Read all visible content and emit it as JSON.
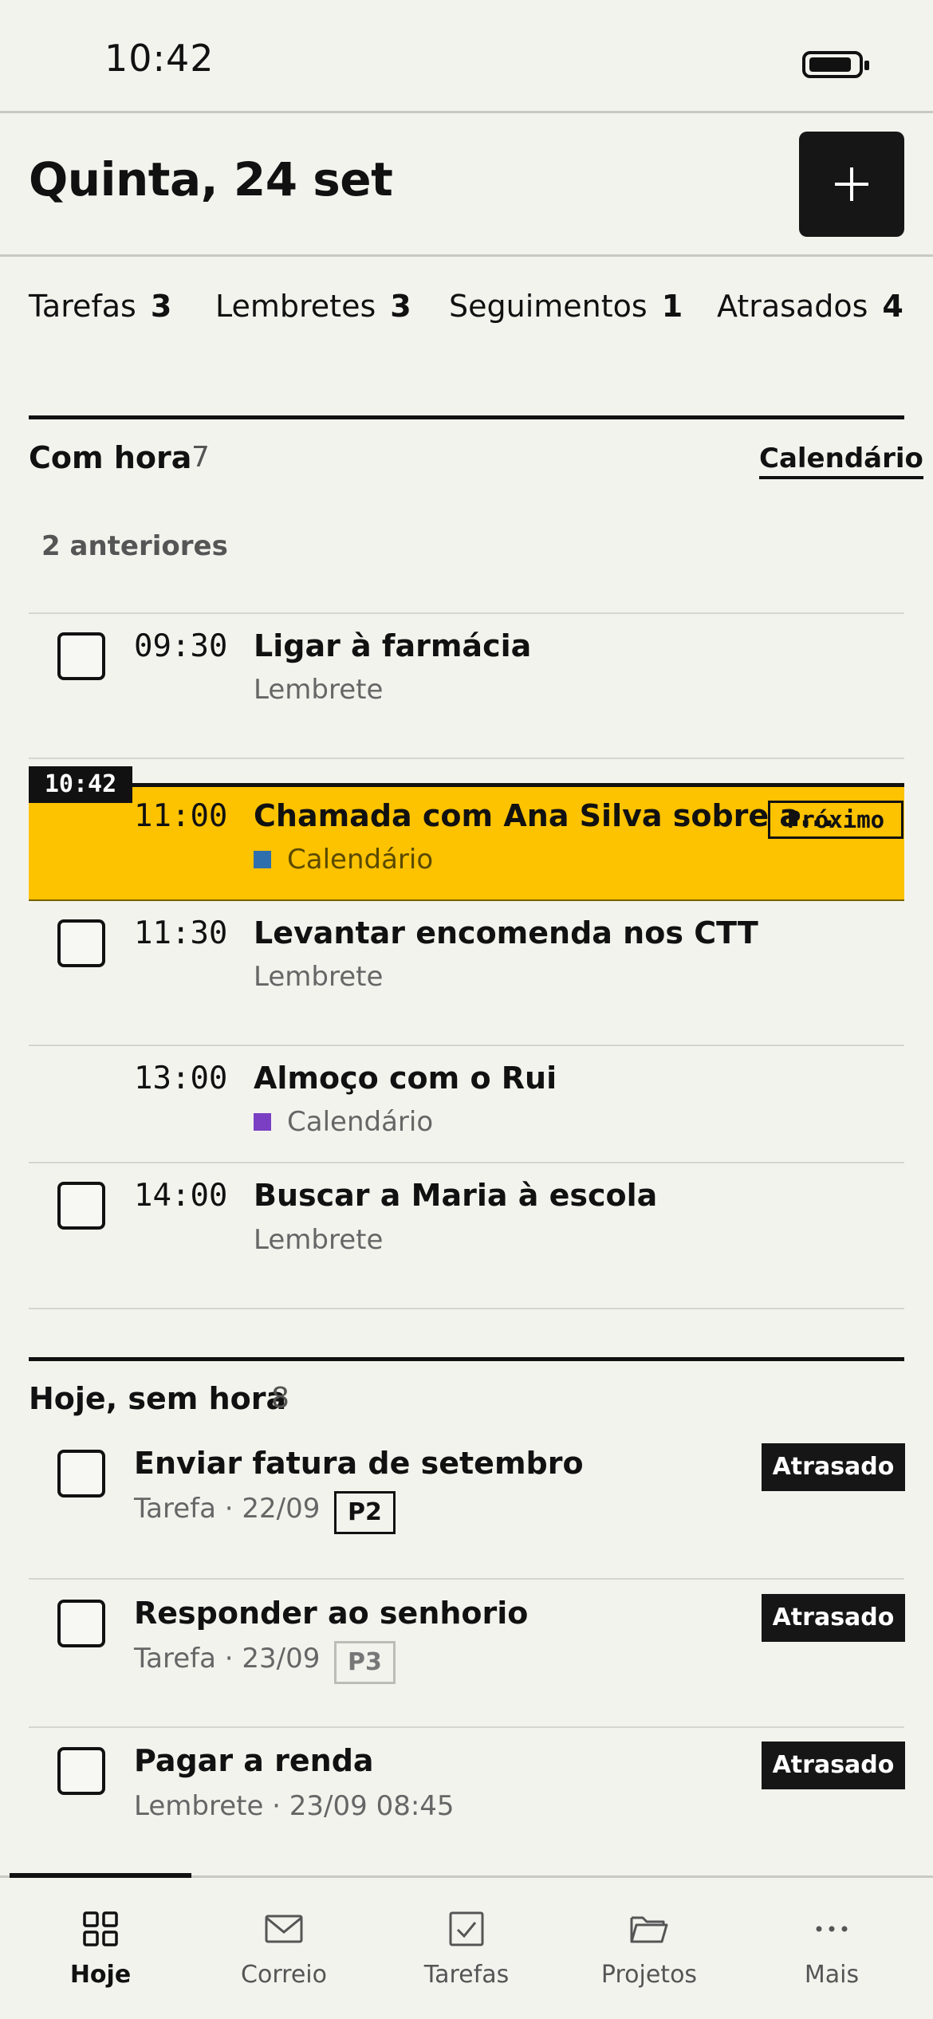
{
  "status_bar": {
    "time": "10:42",
    "battery_icon": "battery-icon"
  },
  "header": {
    "title": "Quinta, 24 set",
    "add_icon": "plus-icon"
  },
  "summary": [
    {
      "label": "Tarefas",
      "count": "3"
    },
    {
      "label": "Lembretes",
      "count": "3"
    },
    {
      "label": "Seguimentos",
      "count": "1"
    },
    {
      "label": "Atrasados",
      "count": "4"
    }
  ],
  "timed": {
    "title": "Com hora",
    "count": "7",
    "calendar_link": "Calendário",
    "earlier": "2 anteriores",
    "now_marker": "10:42",
    "items": [
      {
        "time": "09:30",
        "title": "Ligar à farmácia",
        "sub": "Lembrete",
        "checkbox": true
      },
      {
        "time": "11:00",
        "title": "Chamada com Ana Silva sobre a...",
        "sub": "Calendário",
        "badge": "Próximo",
        "calendar_color": "#2f6fad"
      },
      {
        "time": "11:30",
        "title": "Levantar encomenda nos CTT",
        "sub": "Lembrete",
        "checkbox": true
      },
      {
        "time": "13:00",
        "title": "Almoço com o Rui",
        "sub": "Calendário",
        "calendar_color": "#7b3fc4"
      },
      {
        "time": "14:00",
        "title": "Buscar a Maria à escola",
        "sub": "Lembrete",
        "checkbox": true
      }
    ]
  },
  "untimed": {
    "title": "Hoje, sem hora",
    "count": "8",
    "items": [
      {
        "title": "Enviar fatura de setembro",
        "sub": "Tarefa · 22/09",
        "priority": "P2",
        "badge": "Atrasado"
      },
      {
        "title": "Responder ao senhorio",
        "sub": "Tarefa · 23/09",
        "priority": "P3",
        "badge": "Atrasado"
      },
      {
        "title": "Pagar a renda",
        "sub": "Lembrete · 23/09 08:45",
        "badge": "Atrasado"
      }
    ]
  },
  "nav": [
    {
      "label": "Hoje",
      "icon": "grid-icon",
      "active": true
    },
    {
      "label": "Correio",
      "icon": "mail-icon"
    },
    {
      "label": "Tarefas",
      "icon": "checkbox-icon"
    },
    {
      "label": "Projetos",
      "icon": "folder-icon"
    },
    {
      "label": "Mais",
      "icon": "more-icon"
    }
  ],
  "colors": {
    "background": "#f3f3ee",
    "highlight": "#fdc200",
    "ink": "#111111"
  }
}
